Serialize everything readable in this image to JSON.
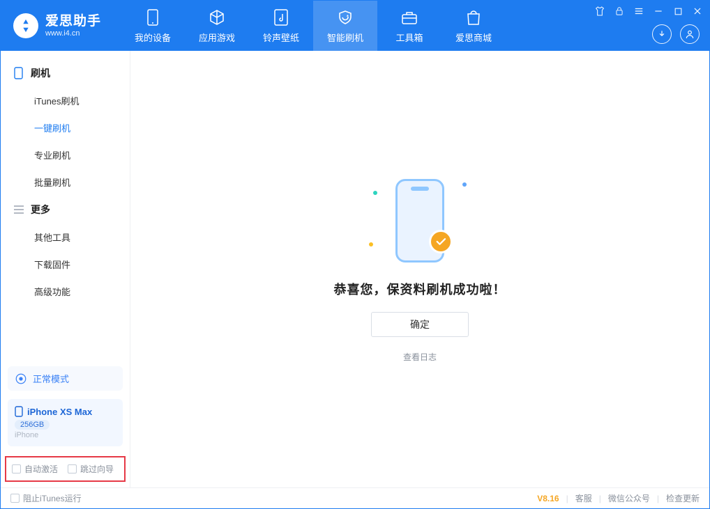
{
  "app": {
    "name_cn": "爱思助手",
    "name_en": "www.i4.cn"
  },
  "nav": {
    "my_device": "我的设备",
    "apps_games": "应用游戏",
    "ringtones": "铃声壁纸",
    "smart_flash": "智能刷机",
    "toolbox": "工具箱",
    "store": "爱思商城"
  },
  "sidebar": {
    "group_flash": "刷机",
    "items_flash": [
      "iTunes刷机",
      "一键刷机",
      "专业刷机",
      "批量刷机"
    ],
    "group_more": "更多",
    "items_more": [
      "其他工具",
      "下载固件",
      "高级功能"
    ]
  },
  "mode_card": {
    "label": "正常模式"
  },
  "device": {
    "name": "iPhone XS Max",
    "storage": "256GB",
    "label": "iPhone"
  },
  "bottom_checks": {
    "auto_activate": "自动激活",
    "skip_guide": "跳过向导"
  },
  "main": {
    "success_msg": "恭喜您，保资料刷机成功啦！",
    "ok": "确定",
    "view_log": "查看日志"
  },
  "status": {
    "block_itunes": "阻止iTunes运行",
    "version": "V8.16",
    "cs": "客服",
    "wechat": "微信公众号",
    "update": "检查更新"
  }
}
